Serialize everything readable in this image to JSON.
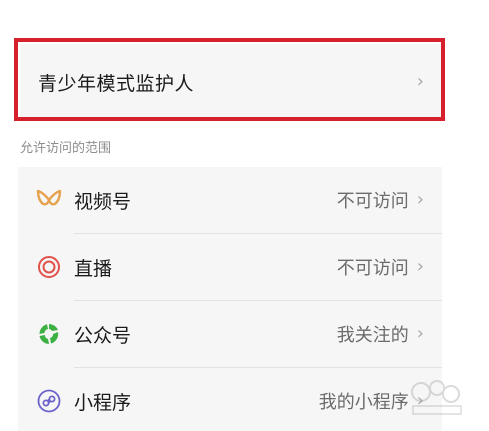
{
  "guardian": {
    "title": "青少年模式监护人"
  },
  "section": {
    "label": "允许访问的范围"
  },
  "items": [
    {
      "label": "视频号",
      "value": "不可访问",
      "icon": "channels-icon",
      "color": "#e6a14c"
    },
    {
      "label": "直播",
      "value": "不可访问",
      "icon": "live-icon",
      "color": "#e0524a"
    },
    {
      "label": "公众号",
      "value": "我关注的",
      "icon": "official-accounts-icon",
      "color": "#3cb043"
    },
    {
      "label": "小程序",
      "value": "我的小程序",
      "icon": "mini-program-icon",
      "color": "#6b63c9"
    }
  ],
  "colors": {
    "highlight": "#d6202b",
    "background": "#f6f6f6"
  }
}
